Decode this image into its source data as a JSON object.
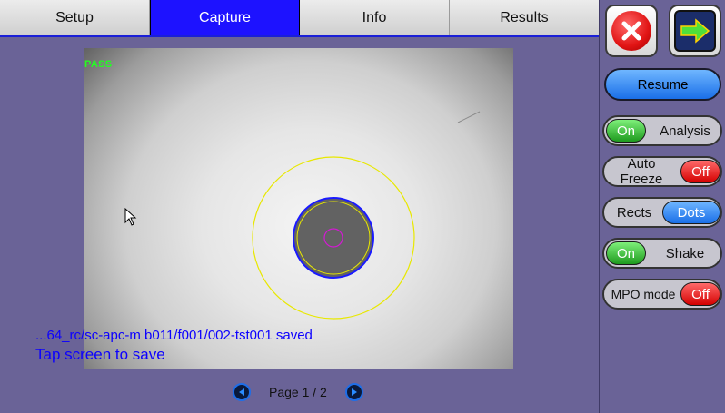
{
  "tabs": [
    {
      "label": "Setup"
    },
    {
      "label": "Capture"
    },
    {
      "label": "Info"
    },
    {
      "label": "Results"
    }
  ],
  "image": {
    "status": "PASS",
    "saved_text": "...64_rc/sc-apc-m b011/f001/002-tst001 saved",
    "tap_text": "Tap screen to save"
  },
  "pager": {
    "label": "Page 1 / 2"
  },
  "panel": {
    "resume": "Resume",
    "analysis": {
      "state": "On",
      "label": "Analysis"
    },
    "auto_freeze": {
      "label": "Auto Freeze",
      "state": "Off"
    },
    "rects_dots": {
      "left": "Rects",
      "right": "Dots"
    },
    "shake": {
      "state": "On",
      "label": "Shake"
    },
    "mpo_mode": {
      "label": "MPO mode",
      "state": "Off"
    }
  },
  "colors": {
    "accent": "#1d12ff",
    "background": "#6a6397",
    "status_pass": "#22ff22",
    "message": "#0c00ff"
  }
}
